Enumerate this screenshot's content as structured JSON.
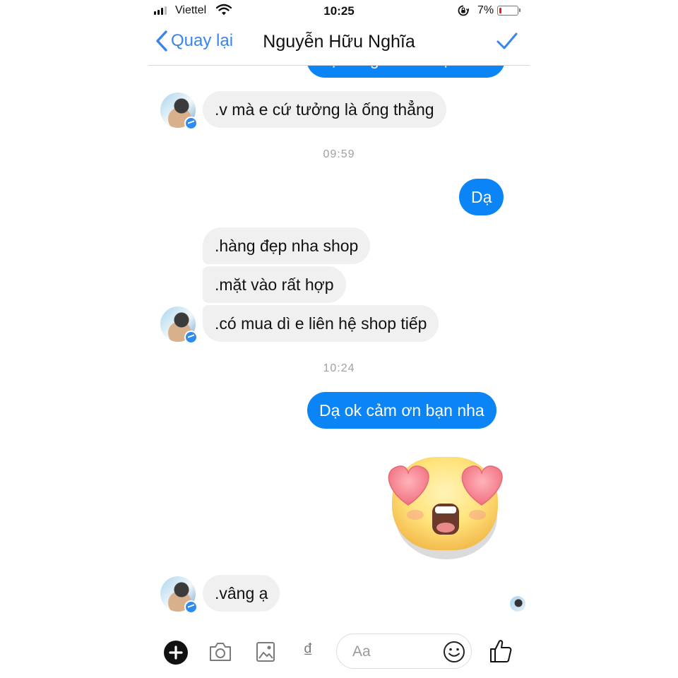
{
  "status_bar": {
    "carrier": "Viettel",
    "time": "10:25",
    "battery": "7%"
  },
  "header": {
    "back_label": "Quay lại",
    "title": "Nguyễn Hữu Nghĩa"
  },
  "messages": {
    "top_partial": "Bạn ống chuẩn bạn nha",
    "m1": ".v mà e cứ tưởng là ống thẳng",
    "t1": "09:59",
    "m2": "Dạ",
    "m3": ".hàng đẹp nha shop",
    "m4": ".mặt vào rất hợp",
    "m5": ".có mua dì e liên hệ shop tiếp",
    "t2": "10:24",
    "m6": "Dạ ok cảm ơn bạn nha",
    "m7": ".vâng ạ"
  },
  "composer": {
    "placeholder": "Aa",
    "currency_symbol": "₫"
  },
  "colors": {
    "accent": "#3a84ee",
    "outgoing_bubble": "#0b84f5",
    "incoming_bubble": "#f0f0f0"
  },
  "icons": [
    "wifi-icon",
    "lock-rotation-icon",
    "battery-icon",
    "back-chevron-icon",
    "checkmark-icon",
    "messenger-badge-icon",
    "heart-eyes-sticker",
    "plus-icon",
    "camera-icon",
    "gallery-icon",
    "smile-icon",
    "thumbs-up-icon"
  ]
}
